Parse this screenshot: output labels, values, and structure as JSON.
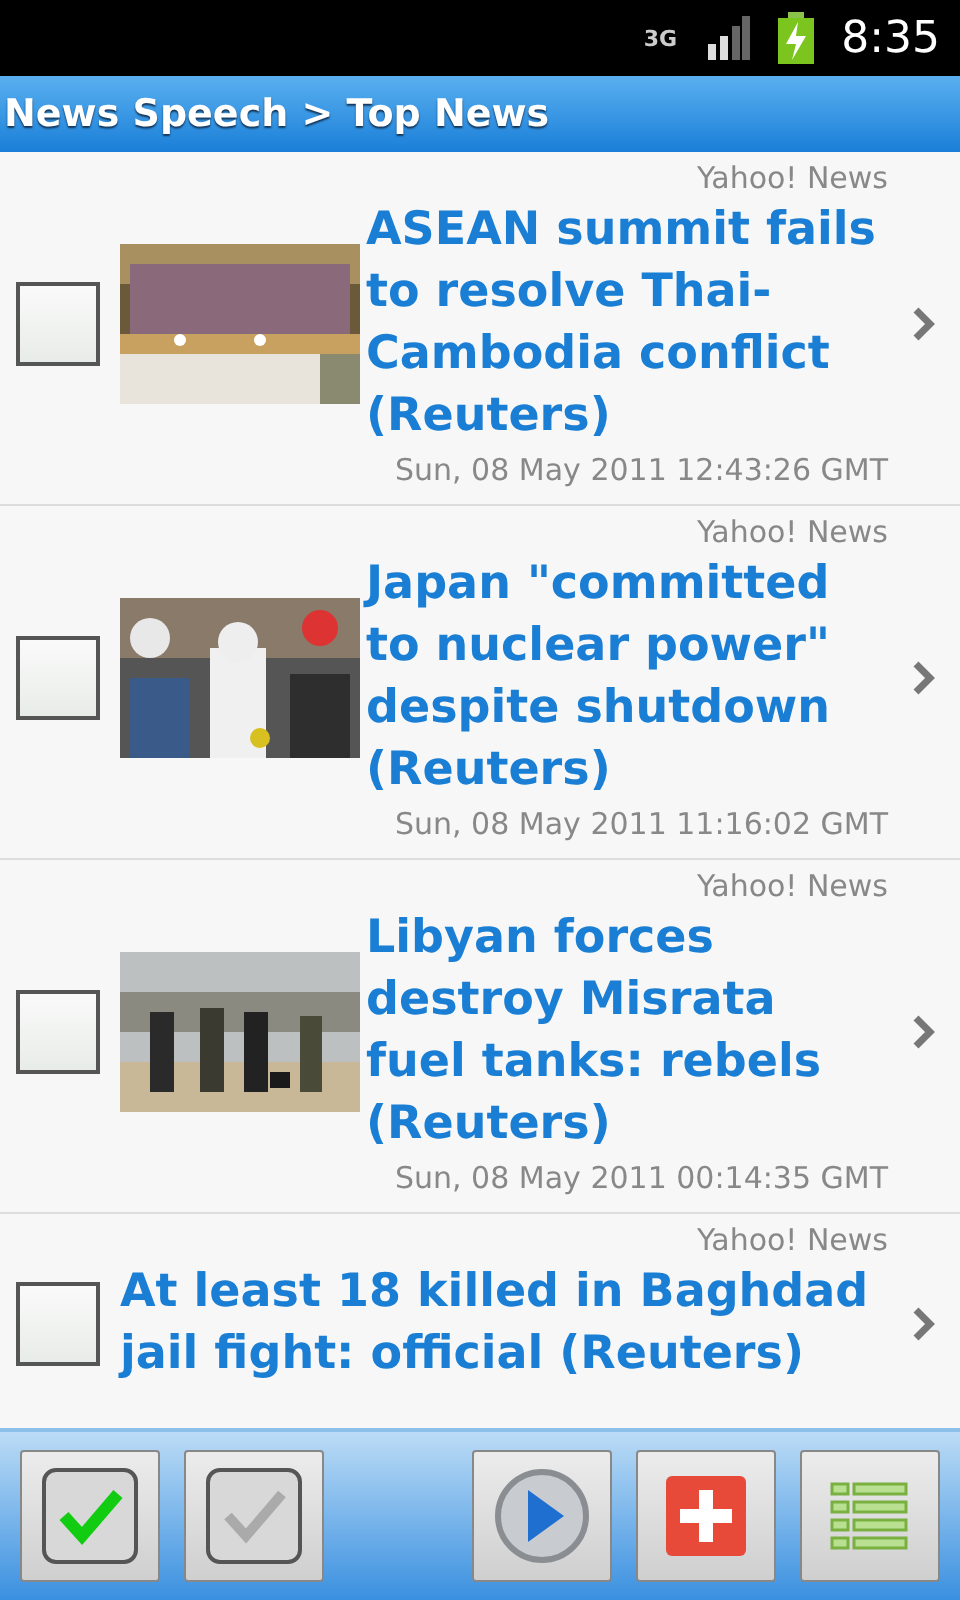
{
  "status_bar": {
    "network": "3G",
    "time": "8:35"
  },
  "title_bar": {
    "title": "News Speech > Top News"
  },
  "items": [
    {
      "source": "Yahoo! News",
      "title": "ASEAN summit fails to resolve Thai-Cambodia conflict (Reuters)",
      "date": "Sun, 08 May 2011 12:43:26 GMT",
      "checked": false
    },
    {
      "source": "Yahoo! News",
      "title": "Japan \"committed to nuclear power\" despite shutdown (Reuters)",
      "date": "Sun, 08 May 2011 11:16:02 GMT",
      "checked": false
    },
    {
      "source": "Yahoo! News",
      "title": "Libyan forces destroy Misrata fuel tanks: rebels (Reuters)",
      "date": "Sun, 08 May 2011 00:14:35 GMT",
      "checked": false
    },
    {
      "source": "Yahoo! News",
      "title": "At least 18 killed in Baghdad jail fight: official (Reuters)",
      "checked": false
    }
  ],
  "toolbar": [
    {
      "kind": "select-all"
    },
    {
      "kind": "deselect-all"
    },
    {
      "kind": "spacer"
    },
    {
      "kind": "play"
    },
    {
      "kind": "add"
    },
    {
      "kind": "list"
    }
  ]
}
